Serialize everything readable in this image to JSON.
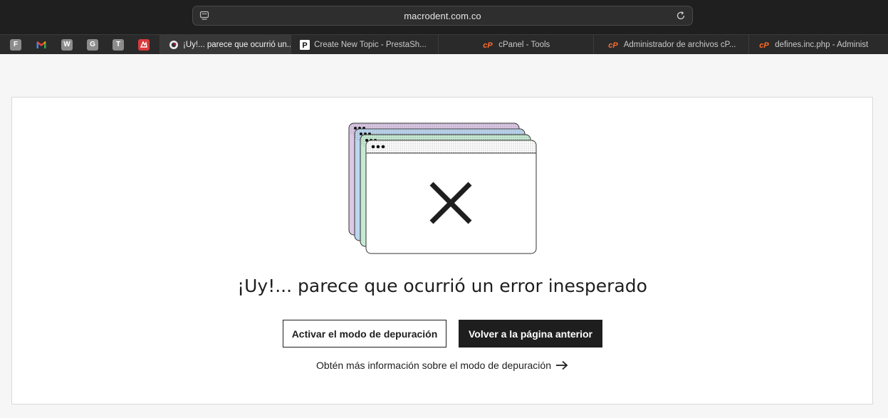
{
  "browser": {
    "url": "macrodent.com.co",
    "pinned_tabs": [
      {
        "letter": "F",
        "icon": "f-letter-icon"
      },
      {
        "letter": "M",
        "icon": "gmail-icon"
      },
      {
        "letter": "W",
        "icon": "w-letter-icon"
      },
      {
        "letter": "G",
        "icon": "g-letter-icon"
      },
      {
        "letter": "T",
        "icon": "t-letter-icon"
      },
      {
        "letter": "",
        "icon": "red-app-icon"
      }
    ],
    "tabs": [
      {
        "title": "¡Uy!... parece que ocurrió un...",
        "icon": "prestashop-puffin-icon",
        "active": true
      },
      {
        "title": "Create New Topic - PrestaSh...",
        "icon": "p-logo-icon",
        "active": false
      },
      {
        "title": "cPanel - Tools",
        "icon": "cpanel-icon",
        "active": false
      },
      {
        "title": "Administrador de archivos cP...",
        "icon": "cpanel-icon",
        "active": false
      },
      {
        "title": "defines.inc.php - Administ",
        "icon": "cpanel-icon",
        "active": false
      }
    ]
  },
  "error_page": {
    "heading": "¡Uy!... parece que ocurrió un error inesperado",
    "debug_button": "Activar el modo de depuración",
    "back_button": "Volver a la página anterior",
    "more_info_link": "Obtén más información sobre el modo de depuración"
  },
  "colors": {
    "window_purple": "#dcc8e6",
    "window_blue": "#bcd6ef",
    "window_green": "#c6ead2",
    "dark": "#1e1e1e",
    "cpanel_orange": "#ff6c2c"
  }
}
